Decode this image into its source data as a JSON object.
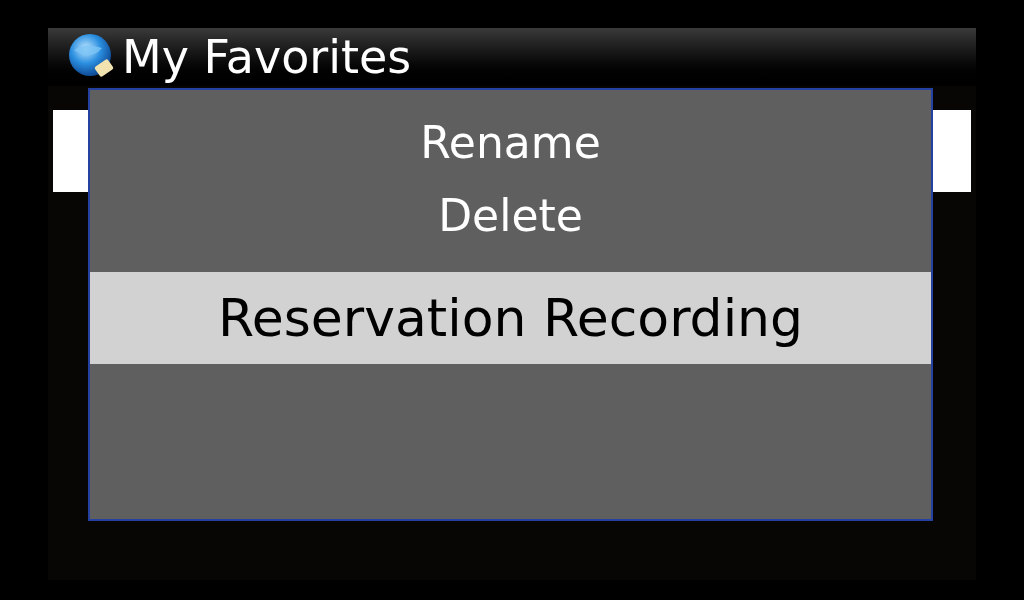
{
  "header": {
    "title": "My Favorites"
  },
  "menu": {
    "items": [
      {
        "label": "Rename",
        "selected": false
      },
      {
        "label": "Delete",
        "selected": false
      },
      {
        "label": "Reservation Recording",
        "selected": true
      }
    ]
  }
}
